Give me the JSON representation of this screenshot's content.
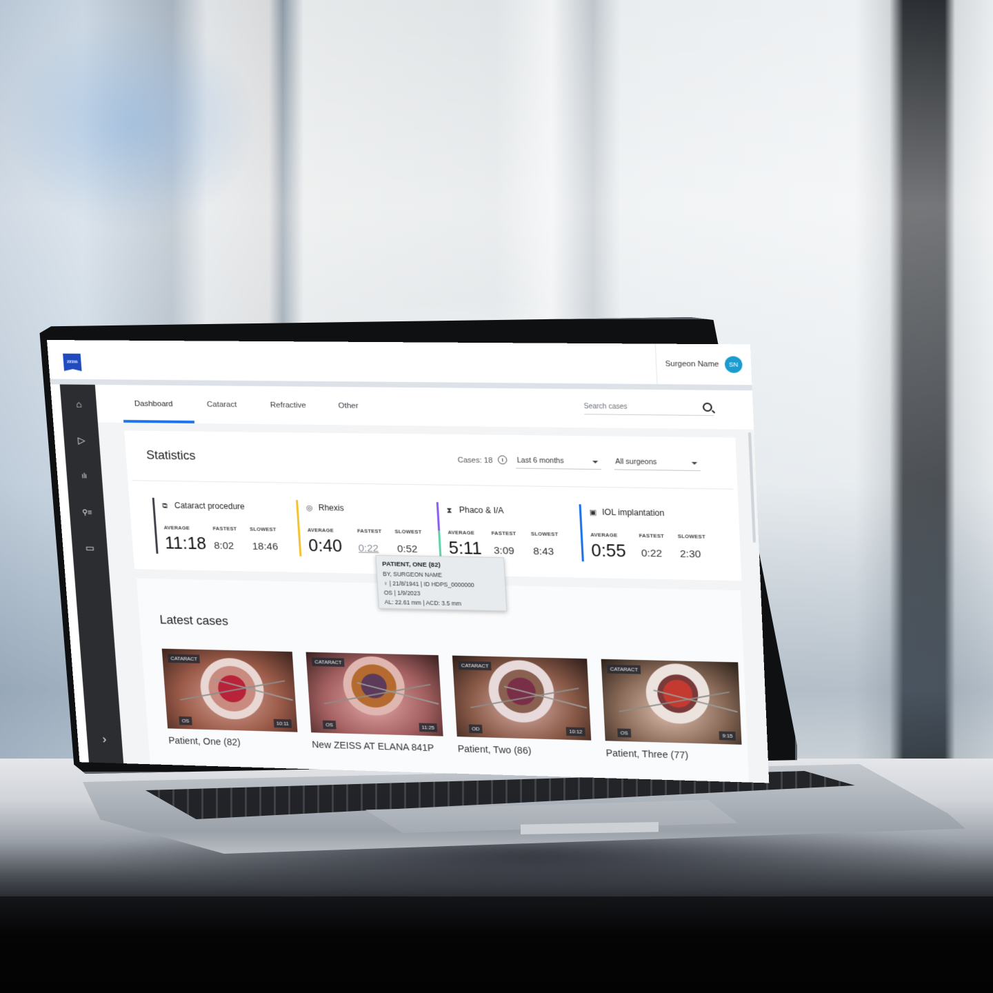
{
  "app": {
    "logo_text": "ZEISS",
    "user": {
      "name": "Surgeon Name",
      "initials": "SN"
    },
    "colors": {
      "accent": "#1a73e8",
      "avatar": "#1a9ccf",
      "sidebar": "#2b2d31",
      "logo": "#1f4bbf",
      "cataract_bar": "#3d4047",
      "rhexis_bar": "#f2c230",
      "phaco_bar_top": "#8a5cf0",
      "phaco_bar_bottom": "#5fd3a8",
      "iol_bar": "#1a73e8"
    }
  },
  "sidebar": {
    "items": [
      {
        "name": "home",
        "icon": "⌂"
      },
      {
        "name": "play",
        "icon": "▷"
      },
      {
        "name": "statistics",
        "icon": "ılı"
      },
      {
        "name": "patients",
        "icon": "⚲≡"
      },
      {
        "name": "messages",
        "icon": "▭"
      }
    ],
    "expand_icon": "›"
  },
  "tabs": [
    {
      "label": "Dashboard",
      "active": true
    },
    {
      "label": "Cataract",
      "active": false
    },
    {
      "label": "Refractive",
      "active": false
    },
    {
      "label": "Other",
      "active": false
    }
  ],
  "search": {
    "placeholder": "Search cases"
  },
  "statistics": {
    "title": "Statistics",
    "cases_label": "Cases: 18",
    "info_icon": "i",
    "period_select": "Last 6 months",
    "surgeon_select": "All surgeons",
    "labels": {
      "average": "AVERAGE",
      "fastest": "FASTEST",
      "slowest": "SLOWEST"
    },
    "metrics": [
      {
        "name": "Cataract procedure",
        "icon": "⧉",
        "average": "11:18",
        "fastest": "8:02",
        "slowest": "18:46"
      },
      {
        "name": "Rhexis",
        "icon": "◎",
        "average": "0:40",
        "fastest": "0:22",
        "slowest": "0:52"
      },
      {
        "name": "Phaco & I/A",
        "icon": "⧗",
        "average": "5:11",
        "fastest": "3:09",
        "slowest": "8:43"
      },
      {
        "name": "IOL implantation",
        "icon": "▣",
        "average": "0:55",
        "fastest": "0:22",
        "slowest": "2:30"
      }
    ]
  },
  "tooltip": {
    "patient": "PATIENT, ONE (82)",
    "by": "BY, SURGEON NAME",
    "line3": "♀ | 21/8/1941 | ID HDPS_0000000",
    "line4": "OS | 1/9/2023",
    "line5": "AL: 22.61 mm | ACD: 3.5 mm"
  },
  "latest_cases": {
    "title": "Latest cases",
    "items": [
      {
        "category": "CATARACT",
        "eye": "OS",
        "duration": "10:11",
        "name": "Patient, One (82)"
      },
      {
        "category": "CATARACT",
        "eye": "OS",
        "duration": "11:25",
        "name": "New ZEISS AT ELANA 841P"
      },
      {
        "category": "CATARACT",
        "eye": "OD",
        "duration": "10:12",
        "name": "Patient, Two (86)"
      },
      {
        "category": "CATARACT",
        "eye": "OS",
        "duration": "9:15",
        "name": "Patient, Three (77)"
      }
    ]
  }
}
